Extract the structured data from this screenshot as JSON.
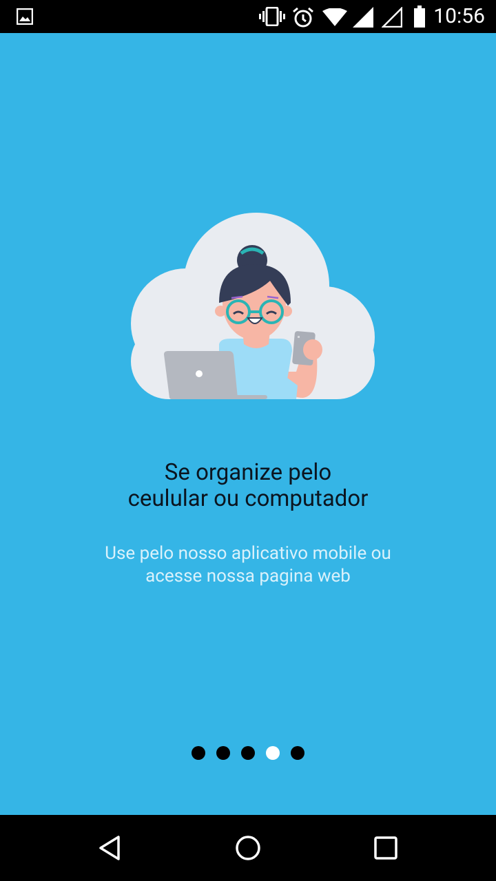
{
  "status_bar": {
    "time": "10:56",
    "icons": [
      "image-icon",
      "vibrate-icon",
      "alarm-icon",
      "wifi-icon",
      "signal-icon",
      "signal-empty-icon",
      "battery-icon"
    ]
  },
  "onboarding": {
    "title_line1": "Se organize pelo",
    "title_line2": "ceulular ou computador",
    "subtitle_line1": "Use pelo nosso aplicativo mobile ou",
    "subtitle_line2": "acesse nossa pagina web",
    "page_indicator": {
      "total": 5,
      "active_index": 3
    },
    "colors": {
      "background": "#35b5e6",
      "cloud": "#e9ecf1",
      "title": "#0b1520",
      "subtitle": "#d9f1fb"
    }
  },
  "nav_bar": {
    "buttons": [
      "back",
      "home",
      "recents"
    ]
  }
}
